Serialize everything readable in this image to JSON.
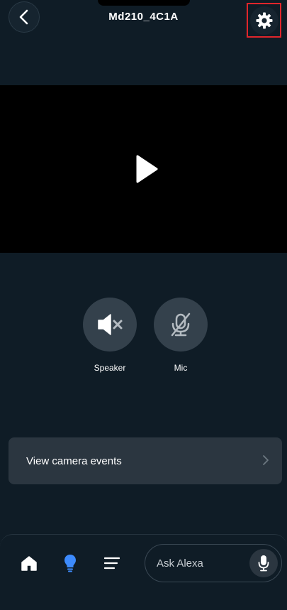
{
  "header": {
    "title": "Md210_4C1A",
    "back_icon": "chevron-left-icon",
    "settings_icon": "gear-icon"
  },
  "video": {
    "play_icon": "play-icon"
  },
  "controls": {
    "speaker": {
      "label": "Speaker",
      "icon": "speaker-muted-icon"
    },
    "mic": {
      "label": "Mic",
      "icon": "mic-off-icon"
    }
  },
  "events": {
    "label": "View camera events",
    "chevron_icon": "chevron-right-icon"
  },
  "bottom_nav": {
    "items": [
      {
        "icon": "home-icon"
      },
      {
        "icon": "lightbulb-icon",
        "color": "#3d8bfd"
      },
      {
        "icon": "menu-lines-icon"
      }
    ],
    "ask": {
      "placeholder": "Ask Alexa",
      "icon": "microphone-icon"
    }
  },
  "colors": {
    "background": "#0f1c26",
    "highlight_box": "#e0262b",
    "accent": "#3d8bfd"
  }
}
